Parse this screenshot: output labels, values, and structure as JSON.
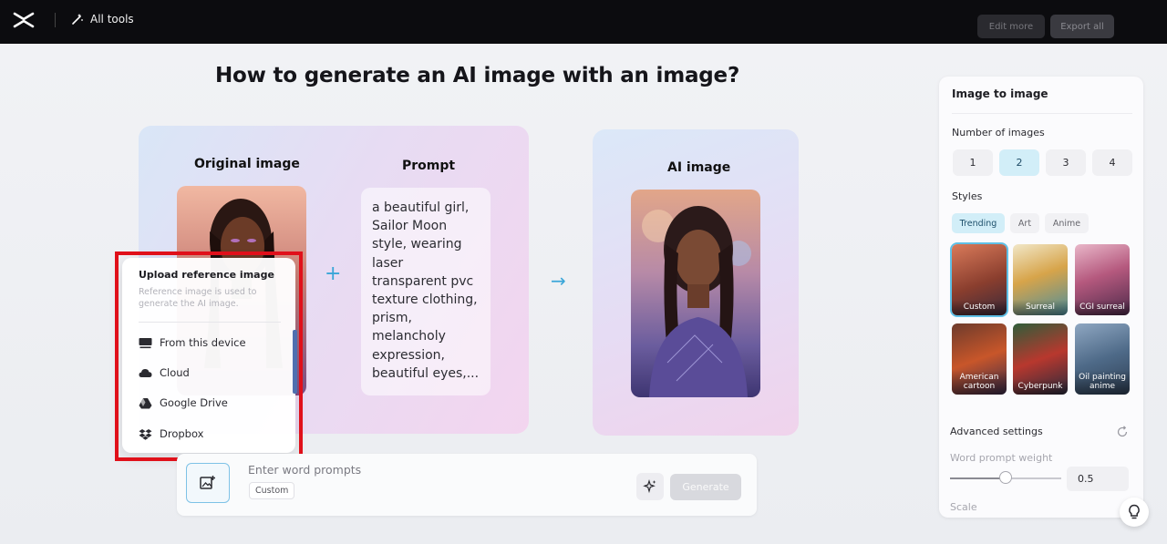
{
  "topbar": {
    "all_tools": "All tools",
    "edit_more": "Edit more",
    "export_all": "Export all"
  },
  "main": {
    "heading": "How to generate an AI image with an image?",
    "original_label": "Original image",
    "prompt_label": "Prompt",
    "ai_label": "AI image",
    "prompt_text": "a beautiful girl, Sailor Moon style, wearing laser transparent pvc texture clothing, prism, melancholy expression, beautiful eyes,..."
  },
  "upload_popup": {
    "title": "Upload reference image",
    "description": "Reference image is used to generate the AI image.",
    "items": [
      {
        "label": "From this device",
        "icon": "monitor-icon"
      },
      {
        "label": "Cloud",
        "icon": "cloud-icon"
      },
      {
        "label": "Google Drive",
        "icon": "google-drive-icon"
      },
      {
        "label": "Dropbox",
        "icon": "dropbox-icon"
      }
    ]
  },
  "prompt_bar": {
    "placeholder": "Enter word prompts",
    "style_chip": "Custom",
    "generate_label": "Generate"
  },
  "panel": {
    "title": "Image to image",
    "number_label": "Number of images",
    "numbers": [
      "1",
      "2",
      "3",
      "4"
    ],
    "selected_number": "2",
    "styles_label": "Styles",
    "style_tabs": [
      "Trending",
      "Art",
      "Anime"
    ],
    "selected_tab": "Trending",
    "styles": [
      "Custom",
      "Surreal",
      "CGI surreal",
      "American cartoon",
      "Cyberpunk",
      "Oil painting anime"
    ],
    "selected_style": "Custom",
    "advanced_label": "Advanced settings",
    "prompt_weight_label": "Word prompt weight",
    "prompt_weight_value": "0.5",
    "prompt_weight_level": 0.5,
    "scale_label": "Scale"
  },
  "colors": {
    "accent": "#3aa6d8",
    "selected_bg": "#d2eef8",
    "highlight_frame": "#e0101a",
    "topbar": "#0c0c0f"
  }
}
